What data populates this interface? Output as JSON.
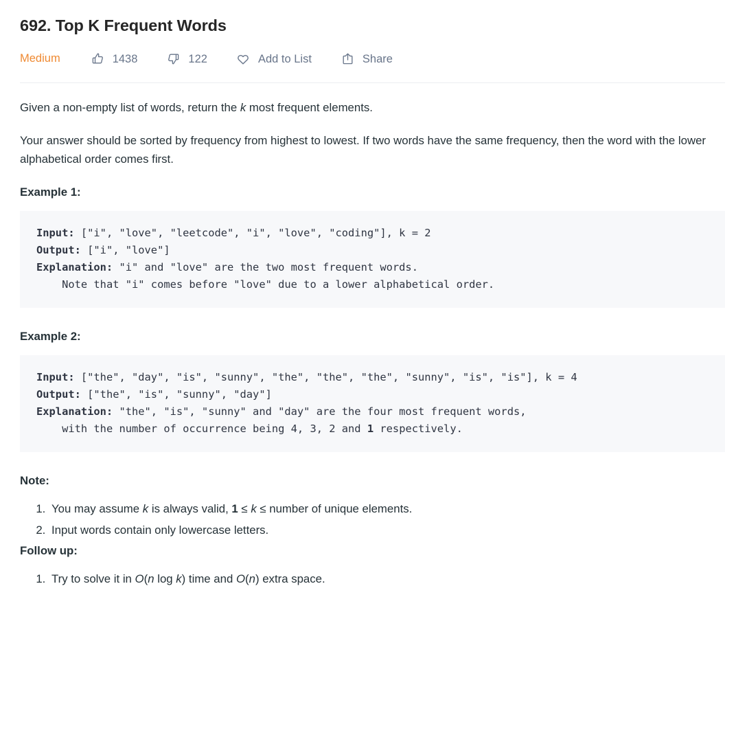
{
  "problem": {
    "title": "692. Top K Frequent Words",
    "difficulty": "Medium",
    "difficulty_color": "#ef8a33"
  },
  "actions": {
    "like": {
      "icon": "thumbs-up-icon",
      "count": "1438"
    },
    "dislike": {
      "icon": "thumbs-down-icon",
      "count": "122"
    },
    "add_to_list": {
      "icon": "heart-icon",
      "label": "Add to List"
    },
    "share": {
      "icon": "share-icon",
      "label": "Share"
    }
  },
  "description": {
    "paragraph1_pre": "Given a non-empty list of words, return the ",
    "paragraph1_var": "k",
    "paragraph1_post": " most frequent elements.",
    "paragraph2": "Your answer should be sorted by frequency from highest to lowest. If two words have the same frequency, then the word with the lower alphabetical order comes first."
  },
  "examples": [
    {
      "heading": "Example 1:",
      "input_label": "Input:",
      "input_value": " [\"i\", \"love\", \"leetcode\", \"i\", \"love\", \"coding\"], k = 2",
      "output_label": "Output:",
      "output_value": " [\"i\", \"love\"]",
      "explanation_label": "Explanation:",
      "explanation_value": " \"i\" and \"love\" are the two most frequent words.\n    Note that \"i\" comes before \"love\" due to a lower alphabetical order."
    },
    {
      "heading": "Example 2:",
      "input_label": "Input:",
      "input_value": " [\"the\", \"day\", \"is\", \"sunny\", \"the\", \"the\", \"the\", \"sunny\", \"is\", \"is\"], k = 4",
      "output_label": "Output:",
      "output_value": " [\"the\", \"is\", \"sunny\", \"day\"]",
      "explanation_label": "Explanation:",
      "explanation_pre": " \"the\", \"is\", \"sunny\" and \"day\" are the four most frequent words,\n    with the number of occurrence being 4, 3, 2 and ",
      "explanation_bold": "1",
      "explanation_post": " respectively."
    }
  ],
  "note": {
    "heading": "Note:",
    "item1_pre": "You may assume ",
    "item1_var": "k",
    "item1_mid": " is always valid, ",
    "item1_bold": "1",
    "item1_le1": " ≤ ",
    "item1_var2": "k",
    "item1_le2": " ≤ ",
    "item1_post": "number of unique elements.",
    "item2": "Input words contain only lowercase letters."
  },
  "follow_up": {
    "heading": "Follow up:",
    "item1_pre": "Try to solve it in ",
    "item1_big_o_1": "O",
    "item1_paren1_open": "(",
    "item1_n1": "n",
    "item1_log": " log ",
    "item1_k": "k",
    "item1_paren1_close": ")",
    "item1_mid": " time and ",
    "item1_big_o_2": "O",
    "item1_paren2_open": "(",
    "item1_n2": "n",
    "item1_paren2_close": ")",
    "item1_post": " extra space."
  }
}
